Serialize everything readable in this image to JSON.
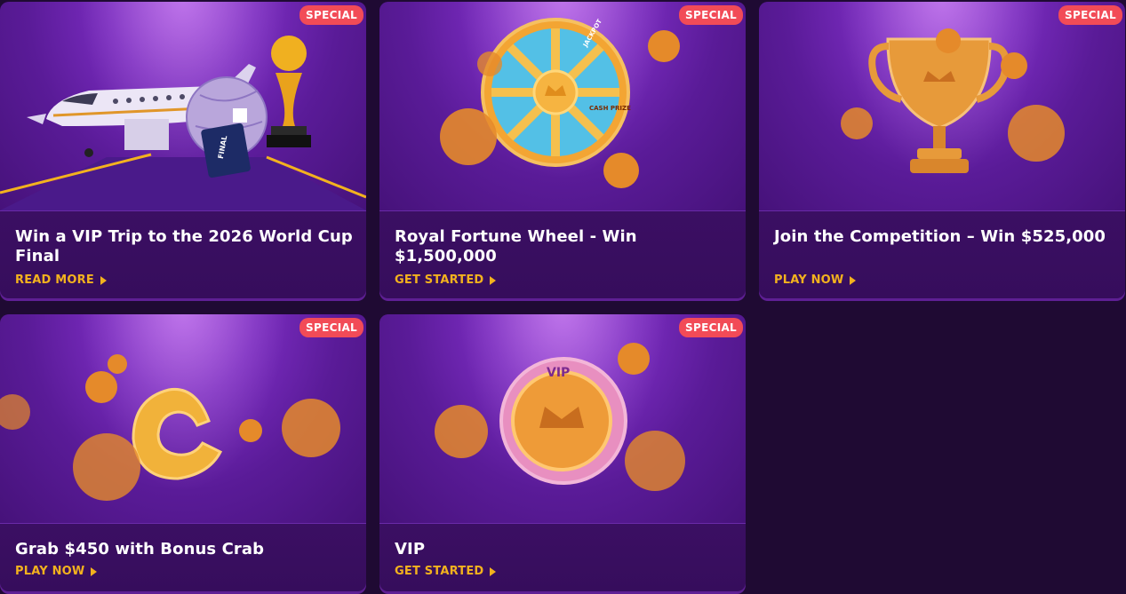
{
  "cards": [
    {
      "badge": "SPECIAL",
      "title": "Win a VIP Trip to the 2026 World Cup Final",
      "cta": "READ MORE",
      "art": "jet-football-trophy-illustration"
    },
    {
      "badge": "SPECIAL",
      "title": "Royal Fortune Wheel - Win $1,500,000",
      "cta": "GET STARTED",
      "art": "fortune-wheel-illustration"
    },
    {
      "badge": "SPECIAL",
      "title": "Join the Competition – Win $525,000",
      "cta": "PLAY NOW",
      "art": "gold-trophy-illustration"
    },
    {
      "badge": "SPECIAL",
      "title": "Grab $450 with Bonus Crab",
      "cta": "PLAY NOW",
      "art": "bonus-crab-coin-illustration"
    },
    {
      "badge": "SPECIAL",
      "title": "VIP",
      "cta": "GET STARTED",
      "art": "vip-coin-illustration"
    }
  ],
  "art_text": {
    "ticket": "FINAL",
    "wheel_jackpot": "JACKPOT",
    "wheel_cash": "CASH PRIZE",
    "vip_coin": "VIP"
  },
  "colors": {
    "page_bg": "#1f0a33",
    "card_bg": "#3d1166",
    "accent": "#f3b21e",
    "badge": "#f24b57"
  }
}
